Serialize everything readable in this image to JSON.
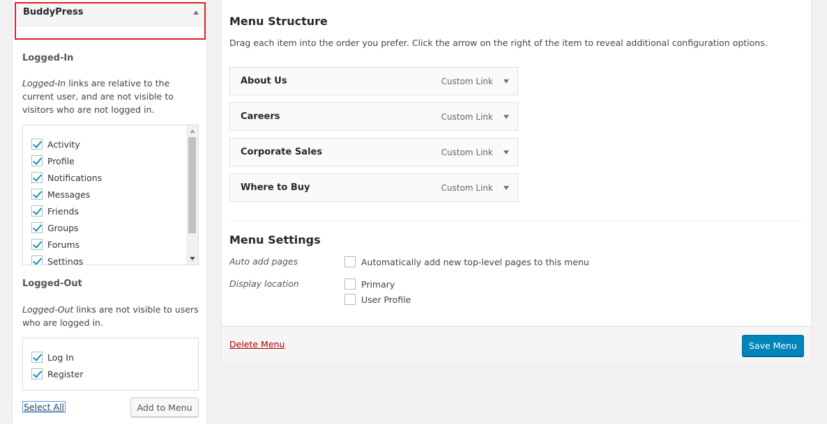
{
  "left": {
    "accordion_title": "BuddyPress",
    "logged_in": {
      "title": "Logged-In",
      "desc_em": "Logged-In",
      "desc_rest": " links are relative to the current user, and are not visible to visitors who are not logged in.",
      "items": [
        "Activity",
        "Profile",
        "Notifications",
        "Messages",
        "Friends",
        "Groups",
        "Forums",
        "Settings"
      ]
    },
    "logged_out": {
      "title": "Logged-Out",
      "desc_em": "Logged-Out",
      "desc_rest": " links are not visible to users who are logged in.",
      "items": [
        "Log In",
        "Register"
      ]
    },
    "select_all": "Select All",
    "add_to_menu": "Add to Menu"
  },
  "right": {
    "structure_title": "Menu Structure",
    "structure_desc": "Drag each item into the order you prefer. Click the arrow on the right of the item to reveal additional configuration options.",
    "menu_items": [
      {
        "title": "About Us",
        "type": "Custom Link"
      },
      {
        "title": "Careers",
        "type": "Custom Link"
      },
      {
        "title": "Corporate Sales",
        "type": "Custom Link"
      },
      {
        "title": "Where to Buy",
        "type": "Custom Link"
      }
    ],
    "settings_title": "Menu Settings",
    "auto_add_label": "Auto add pages",
    "auto_add_option": "Automatically add new top-level pages to this menu",
    "display_location_label": "Display location",
    "locations": [
      "Primary",
      "User Profile"
    ],
    "delete_menu": "Delete Menu",
    "save_menu": "Save Menu"
  }
}
